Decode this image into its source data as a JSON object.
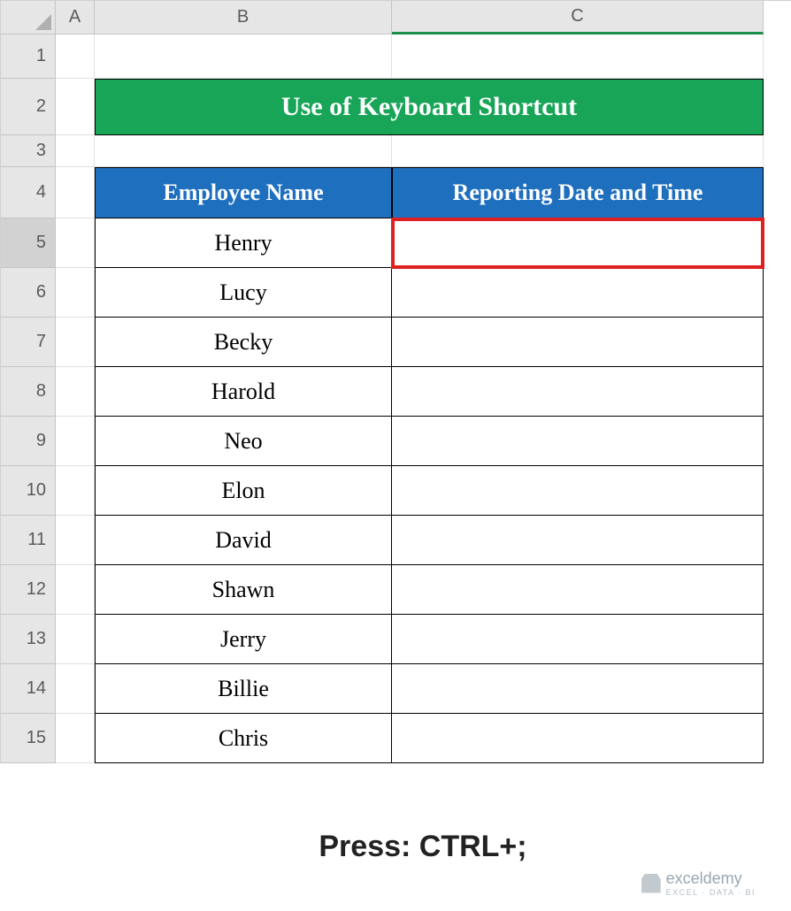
{
  "columns": [
    "A",
    "B",
    "C"
  ],
  "rows": [
    "1",
    "2",
    "3",
    "4",
    "5",
    "6",
    "7",
    "8",
    "9",
    "10",
    "11",
    "12",
    "13",
    "14",
    "15"
  ],
  "title": "Use of Keyboard Shortcut",
  "headers": {
    "b": "Employee Name",
    "c": "Reporting Date and Time"
  },
  "employees": [
    "Henry",
    "Lucy",
    "Becky",
    "Harold",
    "Neo",
    "Elon",
    "David",
    "Shawn",
    "Jerry",
    "Billie",
    "Chris"
  ],
  "active_row": "5",
  "active_col": "C",
  "instruction": "Press: CTRL+;",
  "watermark": {
    "brand": "exceldemy",
    "tag": "EXCEL · DATA · BI"
  }
}
